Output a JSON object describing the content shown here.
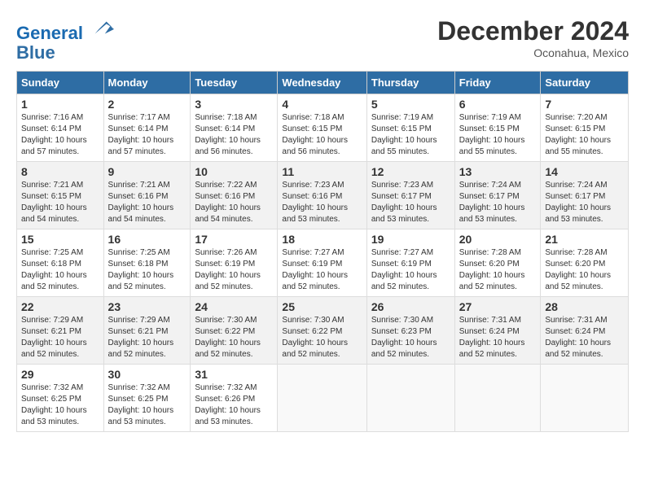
{
  "header": {
    "logo_line1": "General",
    "logo_line2": "Blue",
    "month": "December 2024",
    "location": "Oconahua, Mexico"
  },
  "days_of_week": [
    "Sunday",
    "Monday",
    "Tuesday",
    "Wednesday",
    "Thursday",
    "Friday",
    "Saturday"
  ],
  "weeks": [
    [
      {
        "day": "1",
        "sunrise": "7:16 AM",
        "sunset": "6:14 PM",
        "daylight": "10 hours and 57 minutes."
      },
      {
        "day": "2",
        "sunrise": "7:17 AM",
        "sunset": "6:14 PM",
        "daylight": "10 hours and 57 minutes."
      },
      {
        "day": "3",
        "sunrise": "7:18 AM",
        "sunset": "6:14 PM",
        "daylight": "10 hours and 56 minutes."
      },
      {
        "day": "4",
        "sunrise": "7:18 AM",
        "sunset": "6:15 PM",
        "daylight": "10 hours and 56 minutes."
      },
      {
        "day": "5",
        "sunrise": "7:19 AM",
        "sunset": "6:15 PM",
        "daylight": "10 hours and 55 minutes."
      },
      {
        "day": "6",
        "sunrise": "7:19 AM",
        "sunset": "6:15 PM",
        "daylight": "10 hours and 55 minutes."
      },
      {
        "day": "7",
        "sunrise": "7:20 AM",
        "sunset": "6:15 PM",
        "daylight": "10 hours and 55 minutes."
      }
    ],
    [
      {
        "day": "8",
        "sunrise": "7:21 AM",
        "sunset": "6:15 PM",
        "daylight": "10 hours and 54 minutes."
      },
      {
        "day": "9",
        "sunrise": "7:21 AM",
        "sunset": "6:16 PM",
        "daylight": "10 hours and 54 minutes."
      },
      {
        "day": "10",
        "sunrise": "7:22 AM",
        "sunset": "6:16 PM",
        "daylight": "10 hours and 54 minutes."
      },
      {
        "day": "11",
        "sunrise": "7:23 AM",
        "sunset": "6:16 PM",
        "daylight": "10 hours and 53 minutes."
      },
      {
        "day": "12",
        "sunrise": "7:23 AM",
        "sunset": "6:17 PM",
        "daylight": "10 hours and 53 minutes."
      },
      {
        "day": "13",
        "sunrise": "7:24 AM",
        "sunset": "6:17 PM",
        "daylight": "10 hours and 53 minutes."
      },
      {
        "day": "14",
        "sunrise": "7:24 AM",
        "sunset": "6:17 PM",
        "daylight": "10 hours and 53 minutes."
      }
    ],
    [
      {
        "day": "15",
        "sunrise": "7:25 AM",
        "sunset": "6:18 PM",
        "daylight": "10 hours and 52 minutes."
      },
      {
        "day": "16",
        "sunrise": "7:25 AM",
        "sunset": "6:18 PM",
        "daylight": "10 hours and 52 minutes."
      },
      {
        "day": "17",
        "sunrise": "7:26 AM",
        "sunset": "6:19 PM",
        "daylight": "10 hours and 52 minutes."
      },
      {
        "day": "18",
        "sunrise": "7:27 AM",
        "sunset": "6:19 PM",
        "daylight": "10 hours and 52 minutes."
      },
      {
        "day": "19",
        "sunrise": "7:27 AM",
        "sunset": "6:19 PM",
        "daylight": "10 hours and 52 minutes."
      },
      {
        "day": "20",
        "sunrise": "7:28 AM",
        "sunset": "6:20 PM",
        "daylight": "10 hours and 52 minutes."
      },
      {
        "day": "21",
        "sunrise": "7:28 AM",
        "sunset": "6:20 PM",
        "daylight": "10 hours and 52 minutes."
      }
    ],
    [
      {
        "day": "22",
        "sunrise": "7:29 AM",
        "sunset": "6:21 PM",
        "daylight": "10 hours and 52 minutes."
      },
      {
        "day": "23",
        "sunrise": "7:29 AM",
        "sunset": "6:21 PM",
        "daylight": "10 hours and 52 minutes."
      },
      {
        "day": "24",
        "sunrise": "7:30 AM",
        "sunset": "6:22 PM",
        "daylight": "10 hours and 52 minutes."
      },
      {
        "day": "25",
        "sunrise": "7:30 AM",
        "sunset": "6:22 PM",
        "daylight": "10 hours and 52 minutes."
      },
      {
        "day": "26",
        "sunrise": "7:30 AM",
        "sunset": "6:23 PM",
        "daylight": "10 hours and 52 minutes."
      },
      {
        "day": "27",
        "sunrise": "7:31 AM",
        "sunset": "6:24 PM",
        "daylight": "10 hours and 52 minutes."
      },
      {
        "day": "28",
        "sunrise": "7:31 AM",
        "sunset": "6:24 PM",
        "daylight": "10 hours and 52 minutes."
      }
    ],
    [
      {
        "day": "29",
        "sunrise": "7:32 AM",
        "sunset": "6:25 PM",
        "daylight": "10 hours and 53 minutes."
      },
      {
        "day": "30",
        "sunrise": "7:32 AM",
        "sunset": "6:25 PM",
        "daylight": "10 hours and 53 minutes."
      },
      {
        "day": "31",
        "sunrise": "7:32 AM",
        "sunset": "6:26 PM",
        "daylight": "10 hours and 53 minutes."
      },
      null,
      null,
      null,
      null
    ]
  ],
  "labels": {
    "sunrise": "Sunrise:",
    "sunset": "Sunset:",
    "daylight": "Daylight:"
  }
}
